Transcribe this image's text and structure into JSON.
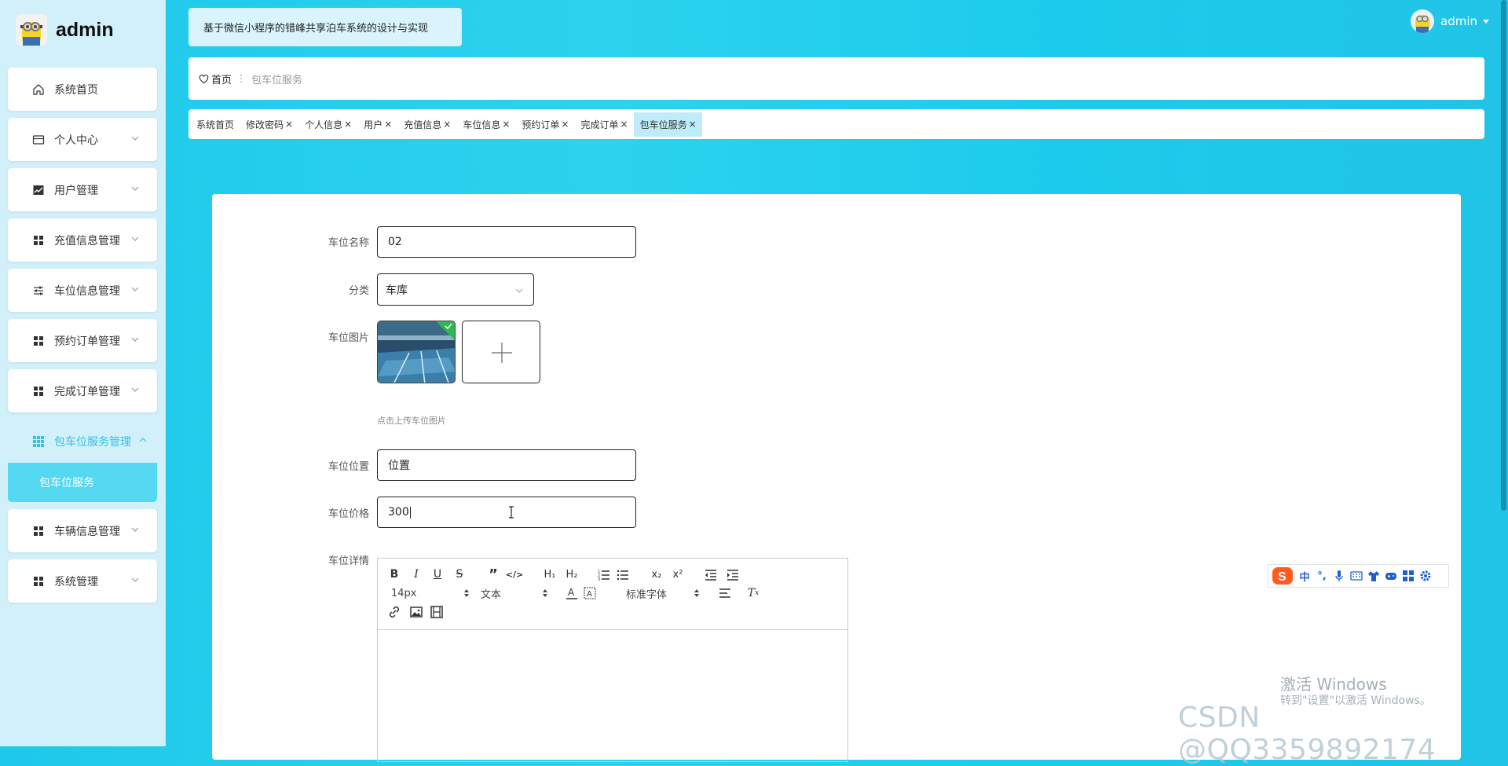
{
  "app": {
    "user_name": "admin",
    "system_title": "基于微信小程序的错峰共享泊车系统的设计与实现"
  },
  "sidebar": {
    "items": [
      {
        "label": "系统首页",
        "icon": "home-icon"
      },
      {
        "label": "个人中心",
        "icon": "card-icon"
      },
      {
        "label": "用户管理",
        "icon": "chart-icon"
      },
      {
        "label": "充值信息管理",
        "icon": "grid-icon"
      },
      {
        "label": "车位信息管理",
        "icon": "sliders-icon"
      },
      {
        "label": "预约订单管理",
        "icon": "grid-icon"
      },
      {
        "label": "完成订单管理",
        "icon": "grid-icon"
      },
      {
        "label": "包车位服务管理",
        "icon": "apps-icon"
      },
      {
        "label": "车辆信息管理",
        "icon": "grid-icon"
      },
      {
        "label": "系统管理",
        "icon": "grid-icon"
      }
    ],
    "active_sub": "包车位服务"
  },
  "header": {
    "user_display": "admin"
  },
  "breadcrumb": {
    "home": "首页",
    "current": "包车位服务"
  },
  "tabs": [
    {
      "label": "系统首页",
      "closable": false
    },
    {
      "label": "修改密码",
      "closable": true
    },
    {
      "label": "个人信息",
      "closable": true
    },
    {
      "label": "用户",
      "closable": true
    },
    {
      "label": "充值信息",
      "closable": true
    },
    {
      "label": "车位信息",
      "closable": true
    },
    {
      "label": "预约订单",
      "closable": true
    },
    {
      "label": "完成订单",
      "closable": true
    },
    {
      "label": "包车位服务",
      "closable": true,
      "active": true
    }
  ],
  "tab_close_glyph": "×",
  "form": {
    "name_label": "车位名称",
    "name_value": "02",
    "category_label": "分类",
    "category_value": "车库",
    "image_label": "车位图片",
    "image_hint": "点击上传车位图片",
    "location_label": "车位位置",
    "location_value": "位置",
    "price_label": "车位价格",
    "price_value": "300",
    "detail_label": "车位详情"
  },
  "editor": {
    "font_size": "14px",
    "text_type": "文本",
    "font_family": "标准字体"
  },
  "ime": {
    "items": [
      "中",
      "°,"
    ]
  },
  "overlay": {
    "activate_title": "激活 Windows",
    "activate_sub": "转到\"设置\"以激活 Windows。",
    "csdn": "CSDN @QQ3359892174"
  },
  "colors": {
    "accent": "#32c2e2",
    "sidebar_bg": "#d2f0fa",
    "sub_active_bg": "#55d8f2",
    "main_bg": "#1ec8ea"
  }
}
